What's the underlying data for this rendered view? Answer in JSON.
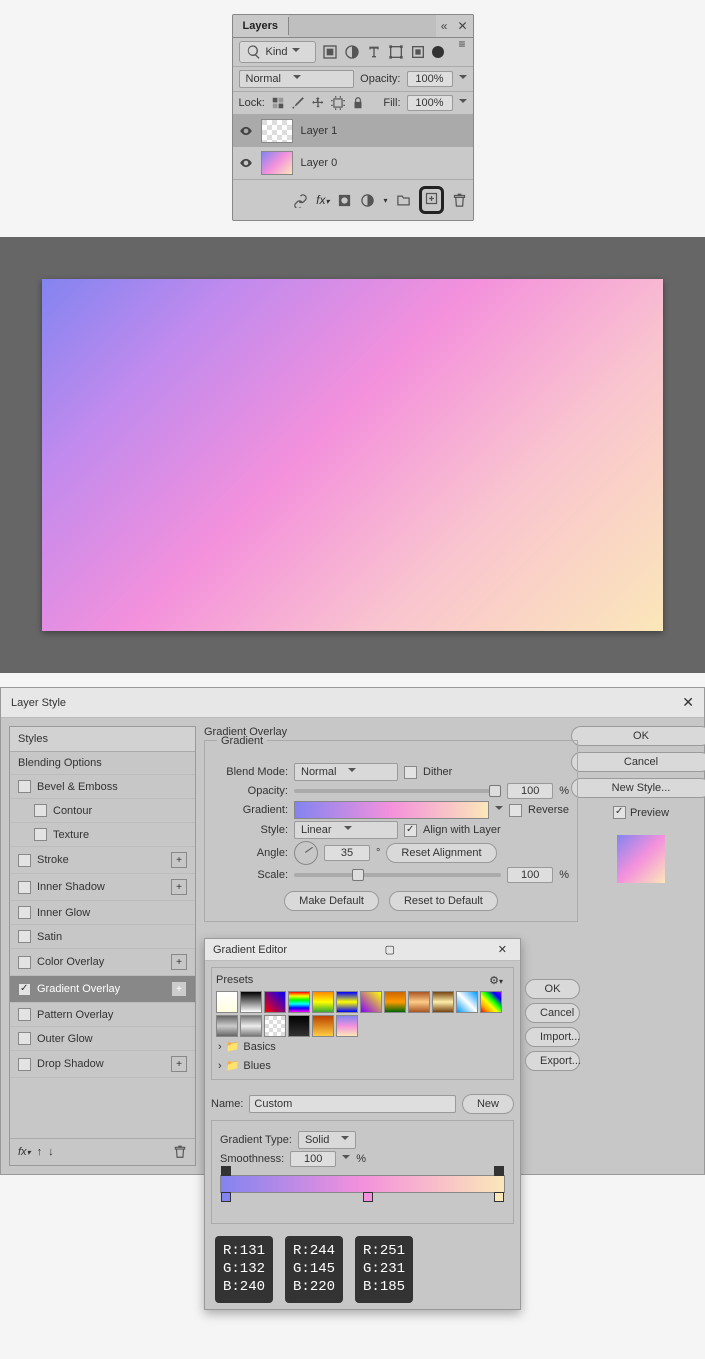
{
  "layers": {
    "title": "Layers",
    "kind": "Kind",
    "blend_mode": "Normal",
    "opacity_label": "Opacity:",
    "opacity_value": "100%",
    "lock_label": "Lock:",
    "fill_label": "Fill:",
    "fill_value": "100%",
    "items": [
      {
        "name": "Layer 1"
      },
      {
        "name": "Layer 0"
      }
    ]
  },
  "layerStyle": {
    "title": "Layer Style",
    "styles_header": "Styles",
    "entries": {
      "blending": "Blending Options",
      "bevel": "Bevel & Emboss",
      "contour": "Contour",
      "texture": "Texture",
      "stroke": "Stroke",
      "innerShadow": "Inner Shadow",
      "innerGlow": "Inner Glow",
      "satin": "Satin",
      "colorOverlay": "Color Overlay",
      "gradientOverlay": "Gradient Overlay",
      "patternOverlay": "Pattern Overlay",
      "outerGlow": "Outer Glow",
      "dropShadow": "Drop Shadow"
    },
    "section": "Gradient Overlay",
    "group": "Gradient",
    "blend_mode_label": "Blend Mode:",
    "blend_mode": "Normal",
    "dither": "Dither",
    "opacity_label": "Opacity:",
    "opacity": "100",
    "pct": "%",
    "gradient_label": "Gradient:",
    "reverse": "Reverse",
    "style_label": "Style:",
    "style": "Linear",
    "align": "Align with Layer",
    "angle_label": "Angle:",
    "angle": "35",
    "deg": "°",
    "reset_align": "Reset Alignment",
    "scale_label": "Scale:",
    "scale": "100",
    "make_default": "Make Default",
    "reset_default": "Reset to Default",
    "ok": "OK",
    "cancel": "Cancel",
    "new_style": "New Style...",
    "preview": "Preview"
  },
  "ge": {
    "title": "Gradient Editor",
    "presets": "Presets",
    "folder1": "Basics",
    "folder2": "Blues",
    "name_label": "Name:",
    "name": "Custom",
    "new": "New",
    "gtype_label": "Gradient Type:",
    "gtype": "Solid",
    "smooth_label": "Smoothness:",
    "smooth": "100",
    "pct": "%",
    "ok": "OK",
    "cancel": "Cancel",
    "import": "Import...",
    "export": "Export...",
    "rgb": [
      {
        "r": "R:131",
        "g": "G:132",
        "b": "B:240"
      },
      {
        "r": "R:244",
        "g": "G:145",
        "b": "B:220"
      },
      {
        "r": "R:251",
        "g": "G:231",
        "b": "B:185"
      }
    ]
  }
}
